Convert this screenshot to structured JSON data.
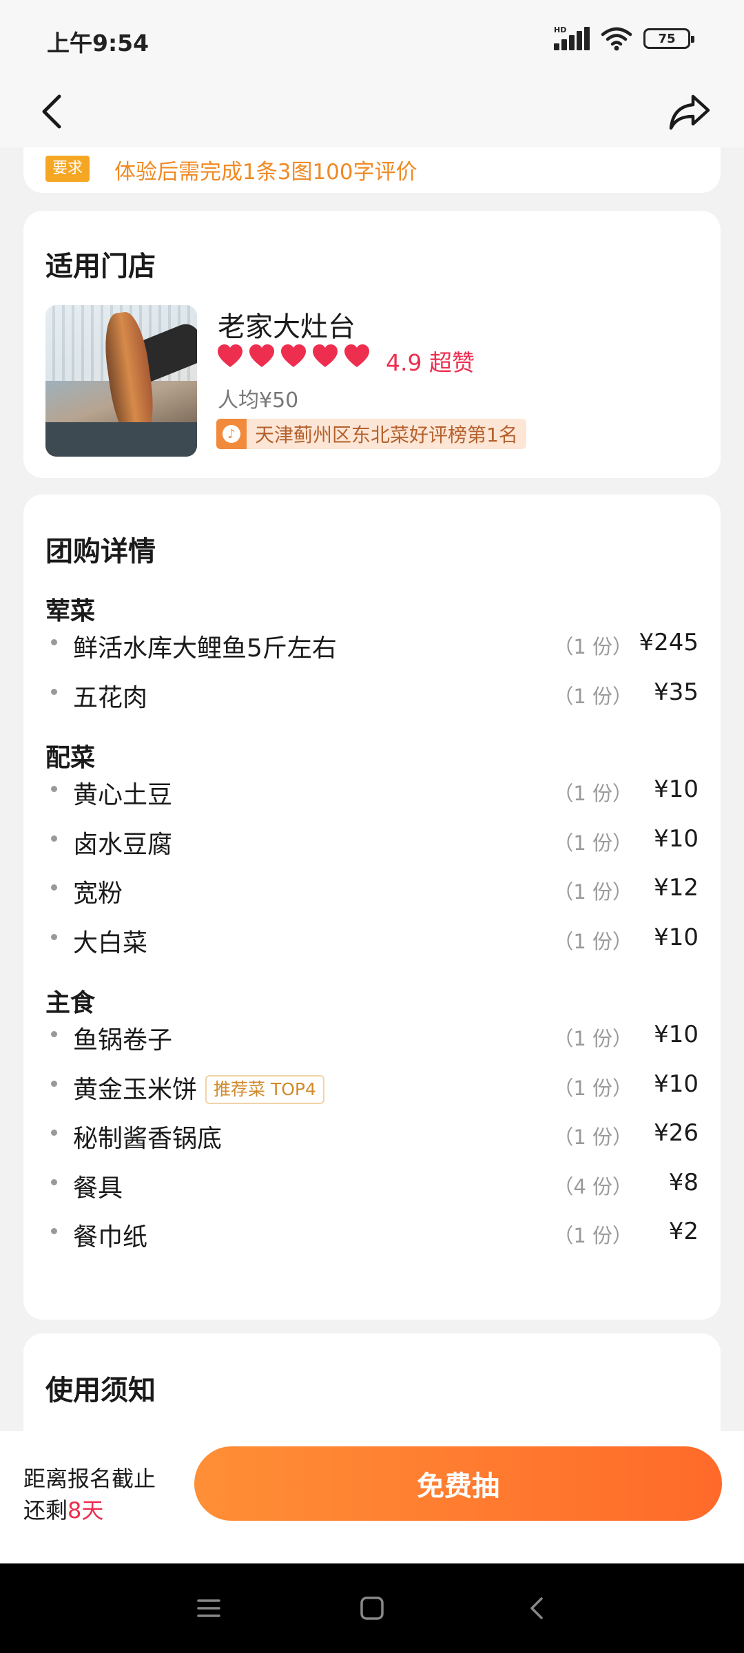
{
  "status_bar": {
    "time": "上午9:54",
    "signal_label": "HD",
    "battery": "75"
  },
  "requirement": {
    "badge": "要求",
    "text": "体验后需完成1条3图100字评价"
  },
  "store": {
    "section_title": "适用门店",
    "name": "老家大灶台",
    "hearts_count": 5,
    "rating": "4.9 超赞",
    "avg_price": "人均¥50",
    "rank_logo": "♪",
    "rank": "天津蓟州区东北菜好评榜第1名"
  },
  "detail": {
    "title": "团购详情",
    "sections": [
      {
        "title": "荤菜",
        "items": [
          {
            "name": "鲜活水库大鲤鱼5斤左右",
            "qty": "（1 份）",
            "price": "¥245"
          },
          {
            "name": "五花肉",
            "qty": "（1 份）",
            "price": "¥35"
          }
        ]
      },
      {
        "title": "配菜",
        "items": [
          {
            "name": "黄心土豆",
            "qty": "（1 份）",
            "price": "¥10"
          },
          {
            "name": "卤水豆腐",
            "qty": "（1 份）",
            "price": "¥10"
          },
          {
            "name": "宽粉",
            "qty": "（1 份）",
            "price": "¥12"
          },
          {
            "name": "大白菜",
            "qty": "（1 份）",
            "price": "¥10"
          }
        ]
      },
      {
        "title": "主食",
        "items": [
          {
            "name": "鱼锅卷子",
            "qty": "（1 份）",
            "price": "¥10"
          },
          {
            "name": "黄金玉米饼",
            "tag": "推荐菜 TOP4",
            "qty": "（1 份）",
            "price": "¥10"
          },
          {
            "name": "秘制酱香锅底",
            "qty": "（1 份）",
            "price": "¥26"
          },
          {
            "name": "餐具",
            "qty": "（4 份）",
            "price": "¥8"
          },
          {
            "name": "餐巾纸",
            "qty": "（1 份）",
            "price": "¥2"
          }
        ]
      }
    ]
  },
  "notice": {
    "title": "使用须知"
  },
  "action_bar": {
    "deadline_line1": "距离报名截止",
    "deadline_prefix": "还剩",
    "deadline_days": "8天",
    "button": "免费抽"
  },
  "colors": {
    "accent": "#ff6a2a",
    "rating": "#ee2e4f",
    "requirement": "#f5a623"
  }
}
